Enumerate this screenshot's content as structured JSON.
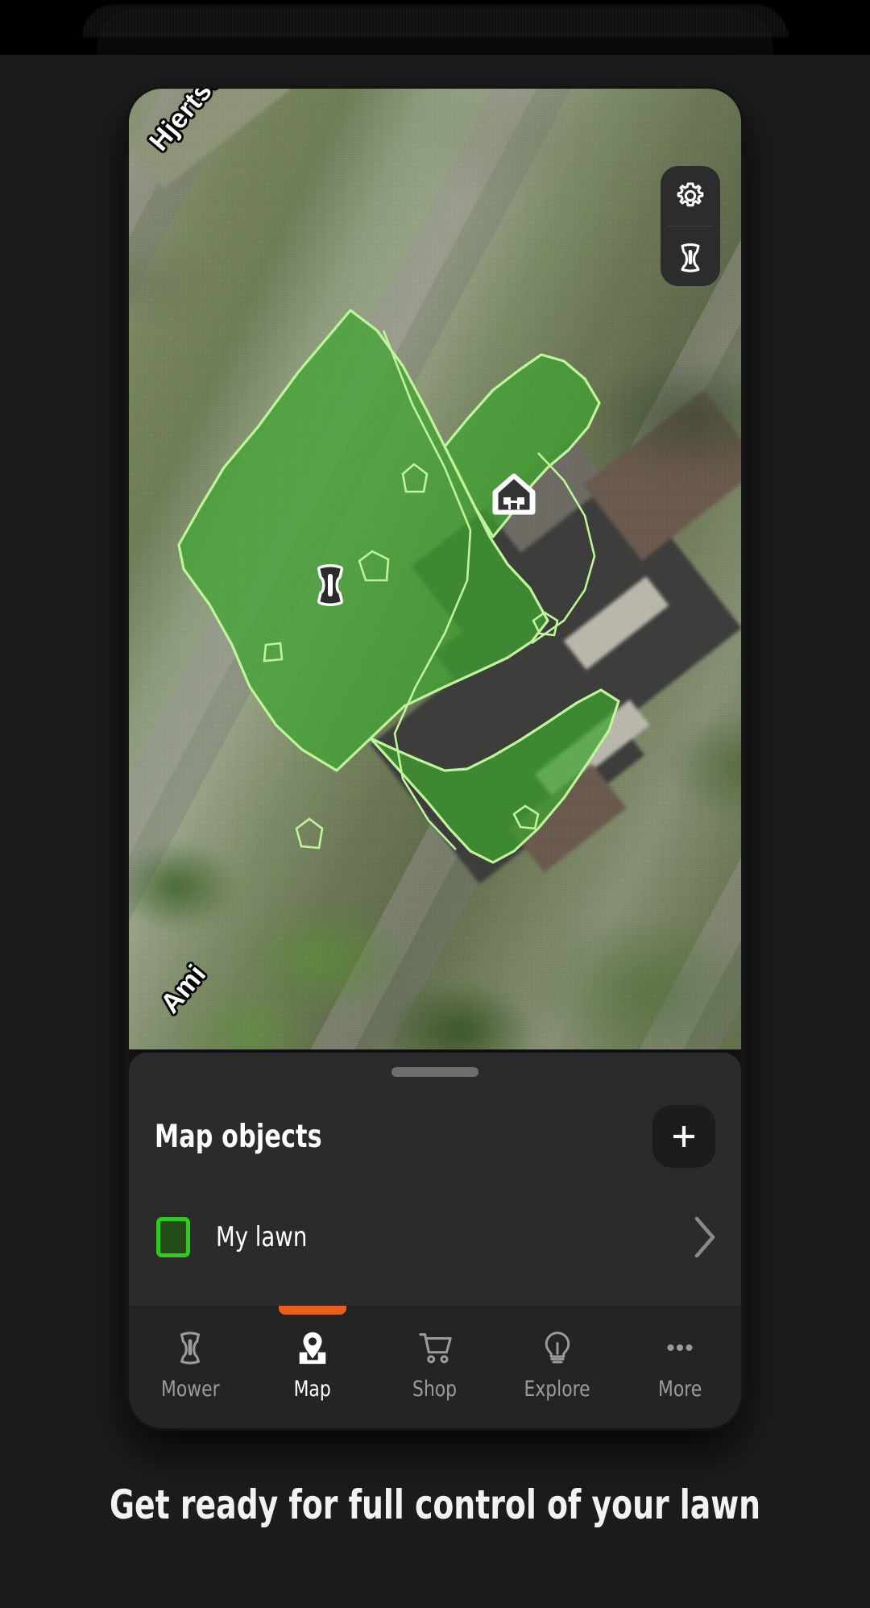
{
  "caption": {
    "text": "Get ready for full control of your lawn"
  },
  "map": {
    "street_labels": [
      {
        "name": "street-label-top",
        "text": "Hjertström"
      },
      {
        "name": "street-label-bottom",
        "text": "Ami"
      }
    ],
    "controls": [
      {
        "name": "map-settings-button",
        "icon": "gear-icon",
        "label": "Settings"
      },
      {
        "name": "map-mower-button",
        "icon": "mower-icon",
        "label": "Mower"
      }
    ],
    "markers": [
      {
        "name": "charging-station-marker",
        "icon": "home-icon",
        "label": "Charging station"
      },
      {
        "name": "mower-position-marker",
        "icon": "mower-icon",
        "label": "Mower"
      }
    ],
    "lawn": {
      "fill_color": "#3FA530",
      "outline_color": "#BFF59A",
      "label": "My lawn"
    }
  },
  "sheet": {
    "title": "Map objects",
    "add_button_label": "+",
    "handle_label": "Drag handle",
    "objects": [
      {
        "label": "My lawn",
        "swatch_border": "#2ECC1E",
        "swatch_fill": "#234C17",
        "chevron": "chevron-right-icon"
      }
    ]
  },
  "bottom_nav": {
    "active_color": "#E8601C",
    "items": [
      {
        "label": "Mower",
        "icon": "mower-icon",
        "active": false
      },
      {
        "label": "Map",
        "icon": "map-pin-icon",
        "active": true
      },
      {
        "label": "Shop",
        "icon": "cart-icon",
        "active": false
      },
      {
        "label": "Explore",
        "icon": "bulb-icon",
        "active": false
      },
      {
        "label": "More",
        "icon": "ellipsis-icon",
        "active": false
      }
    ]
  }
}
